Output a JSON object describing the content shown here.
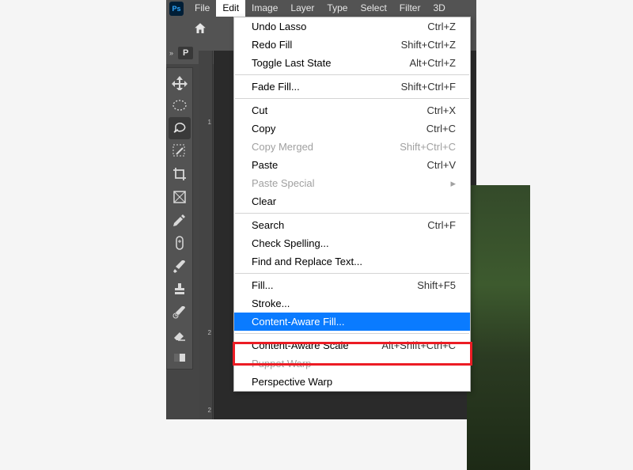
{
  "menubar": {
    "items": [
      "File",
      "Edit",
      "Image",
      "Layer",
      "Type",
      "Select",
      "Filter",
      "3D"
    ]
  },
  "options_tag": "P",
  "tools": [
    {
      "name": "move-icon"
    },
    {
      "name": "marquee-ellipse-icon"
    },
    {
      "name": "lasso-icon",
      "selected": true
    },
    {
      "name": "magic-wand-icon"
    },
    {
      "name": "crop-icon"
    },
    {
      "name": "frame-icon"
    },
    {
      "name": "eyedropper-icon"
    },
    {
      "name": "healing-brush-icon"
    },
    {
      "name": "brush-icon"
    },
    {
      "name": "stamp-icon"
    },
    {
      "name": "history-brush-icon"
    },
    {
      "name": "eraser-icon"
    },
    {
      "name": "gradient-icon"
    }
  ],
  "ruler_ticks": [
    "1",
    "2",
    "2"
  ],
  "dropdown": {
    "groups": [
      [
        {
          "label": "Undo Lasso",
          "shortcut": "Ctrl+Z"
        },
        {
          "label": "Redo Fill",
          "shortcut": "Shift+Ctrl+Z"
        },
        {
          "label": "Toggle Last State",
          "shortcut": "Alt+Ctrl+Z"
        }
      ],
      [
        {
          "label": "Fade Fill...",
          "shortcut": "Shift+Ctrl+F"
        }
      ],
      [
        {
          "label": "Cut",
          "shortcut": "Ctrl+X"
        },
        {
          "label": "Copy",
          "shortcut": "Ctrl+C"
        },
        {
          "label": "Copy Merged",
          "shortcut": "Shift+Ctrl+C",
          "disabled": true
        },
        {
          "label": "Paste",
          "shortcut": "Ctrl+V"
        },
        {
          "label": "Paste Special",
          "shortcut": "",
          "submenu": true,
          "disabled": true
        },
        {
          "label": "Clear",
          "shortcut": ""
        }
      ],
      [
        {
          "label": "Search",
          "shortcut": "Ctrl+F"
        },
        {
          "label": "Check Spelling...",
          "shortcut": ""
        },
        {
          "label": "Find and Replace Text...",
          "shortcut": ""
        }
      ],
      [
        {
          "label": "Fill...",
          "shortcut": "Shift+F5"
        },
        {
          "label": "Stroke...",
          "shortcut": ""
        },
        {
          "label": "Content-Aware Fill...",
          "shortcut": "",
          "highlight": true
        }
      ],
      [
        {
          "label": "Content-Aware Scale",
          "shortcut": "Alt+Shift+Ctrl+C"
        },
        {
          "label": "Puppet Warp",
          "shortcut": "",
          "disabled": true
        },
        {
          "label": "Perspective Warp",
          "shortcut": ""
        }
      ]
    ]
  }
}
